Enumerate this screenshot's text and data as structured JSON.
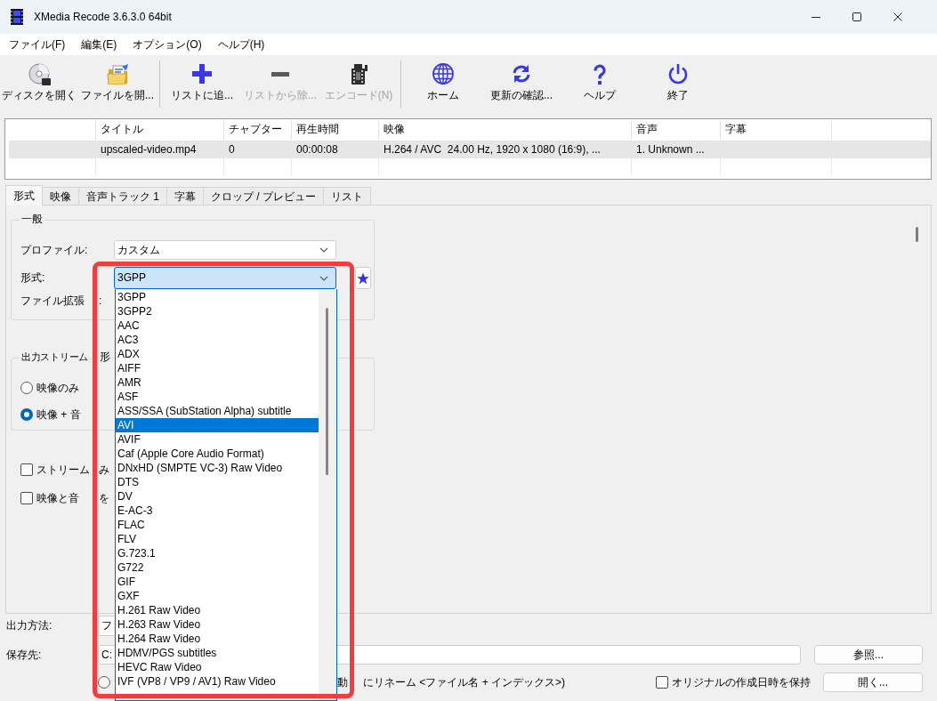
{
  "window": {
    "title": "XMedia Recode 3.6.3.0 64bit"
  },
  "menu": [
    "ファイル(F)",
    "編集(E)",
    "オプション(O)",
    "ヘルプ(H)"
  ],
  "toolbar": [
    {
      "kind": "disc",
      "label": "ディスクを開く",
      "disabled": false
    },
    {
      "kind": "folder",
      "label": "ファイルを開...",
      "disabled": false
    },
    {
      "kind": "separator"
    },
    {
      "kind": "plus",
      "label": "リストに追...",
      "disabled": false
    },
    {
      "kind": "minus",
      "label": "リストから除...",
      "disabled": true
    },
    {
      "kind": "film",
      "label": "エンコード(N)",
      "disabled": true
    },
    {
      "kind": "separator"
    },
    {
      "kind": "globe",
      "label": "ホーム",
      "disabled": false
    },
    {
      "kind": "refresh",
      "label": "更新の確認...",
      "disabled": false
    },
    {
      "kind": "help",
      "label": "ヘルプ",
      "disabled": false
    },
    {
      "kind": "power",
      "label": "終了",
      "disabled": false
    }
  ],
  "file_list": {
    "columns": [
      "タイトル",
      "チャプター",
      "再生時間",
      "映像",
      "音声",
      "字幕"
    ],
    "rows": [
      {
        "selected": true,
        "cells": [
          "upscaled-video.mp4",
          "0",
          "00:00:08",
          "H.264 / AVC  24.00 Hz, 1920 x 1080 (16:9), ...",
          "1. Unknown ..."
        ]
      }
    ]
  },
  "tabs": [
    {
      "label": "形式",
      "selected": true
    },
    {
      "label": "映像",
      "selected": false
    },
    {
      "label": "音声トラック 1",
      "selected": false
    },
    {
      "label": "字幕",
      "selected": false
    },
    {
      "label": "クロップ / プレビュー",
      "selected": false
    },
    {
      "label": "リスト",
      "selected": false
    }
  ],
  "general": {
    "legend": "一般",
    "profile": {
      "label": "プロファイル:",
      "value": "カスタム"
    },
    "format": {
      "label": "形式:",
      "value": "3GPP",
      "open": true
    },
    "extension": {
      "label": "ファイル拡張",
      "tail": ":"
    }
  },
  "output_streams": {
    "legend": "出力ストリーム",
    "legend_tail": "形",
    "options": [
      {
        "label": "映像のみ",
        "selected": false
      },
      {
        "label": "映像 + 音",
        "selected": true
      }
    ]
  },
  "options": [
    {
      "label": "ストリーム",
      "tail": "み",
      "checked": false
    },
    {
      "label": "映像と音",
      "tail": "を",
      "checked": false
    }
  ],
  "output": {
    "method": {
      "label": "出力方法:",
      "value": "フ"
    },
    "destination": {
      "label": "保存先:",
      "value": "C:",
      "browse": "参照..."
    },
    "rename": {
      "selected": false,
      "head": "動",
      "tail": "にリネーム <ファイル名 + インデックス>)"
    },
    "keep_date": {
      "label": "オリジナルの作成日時を保持",
      "checked": false
    },
    "open_button": "開く..."
  },
  "format_list": {
    "items": [
      {
        "label": "3GPP",
        "selected": false
      },
      {
        "label": "3GPP2",
        "selected": false
      },
      {
        "label": "AAC",
        "selected": false
      },
      {
        "label": "AC3",
        "selected": false
      },
      {
        "label": "ADX",
        "selected": false
      },
      {
        "label": "AIFF",
        "selected": false
      },
      {
        "label": "AMR",
        "selected": false
      },
      {
        "label": "ASF",
        "selected": false
      },
      {
        "label": "ASS/SSA (SubStation Alpha) subtitle",
        "selected": false
      },
      {
        "label": "AVI",
        "selected": true
      },
      {
        "label": "AVIF",
        "selected": false
      },
      {
        "label": "Caf (Apple Core Audio Format)",
        "selected": false
      },
      {
        "label": "DNxHD (SMPTE VC-3) Raw Video",
        "selected": false
      },
      {
        "label": "DTS",
        "selected": false
      },
      {
        "label": "DV",
        "selected": false
      },
      {
        "label": "E-AC-3",
        "selected": false
      },
      {
        "label": "FLAC",
        "selected": false
      },
      {
        "label": "FLV",
        "selected": false
      },
      {
        "label": "G.723.1",
        "selected": false
      },
      {
        "label": "G722",
        "selected": false
      },
      {
        "label": "GIF",
        "selected": false
      },
      {
        "label": "GXF",
        "selected": false
      },
      {
        "label": "H.261 Raw Video",
        "selected": false
      },
      {
        "label": "H.263 Raw Video",
        "selected": false
      },
      {
        "label": "H.264 Raw Video",
        "selected": false
      },
      {
        "label": "HDMV/PGS subtitles",
        "selected": false
      },
      {
        "label": "HEVC Raw Video",
        "selected": false
      },
      {
        "label": "IVF (VP8 / VP9 / AV1) Raw Video",
        "selected": false
      }
    ]
  },
  "annotation": {
    "kind": "highlight-frame"
  }
}
